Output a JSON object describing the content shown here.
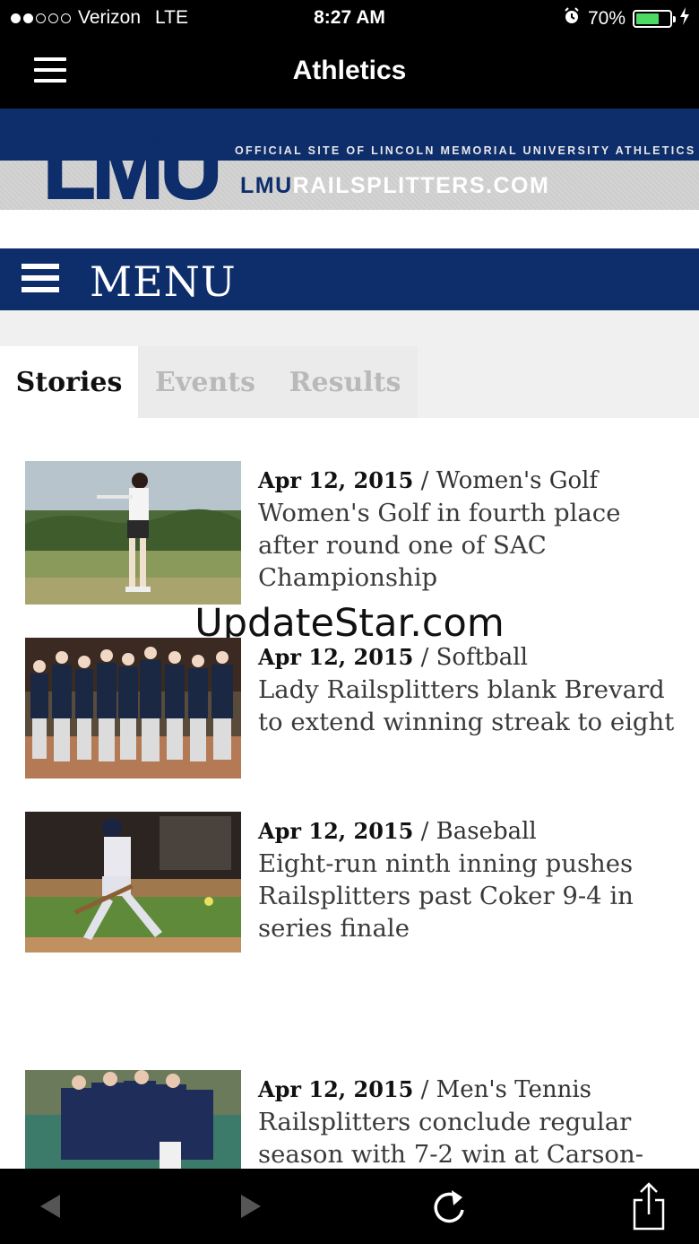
{
  "status_bar": {
    "carrier": "Verizon",
    "network": "LTE",
    "time": "8:27 AM",
    "battery": "70%",
    "battery_level": 0.7,
    "signal_bars_filled": 2,
    "signal_bars_total": 5
  },
  "nav": {
    "title": "Athletics",
    "menu_icon": "hamburger-icon"
  },
  "banner": {
    "logo_text": "LMU",
    "tagline": "OFFICIAL SITE OF LINCOLN MEMORIAL UNIVERSITY ATHLETICS",
    "url_part1": "LMU",
    "url_part2": "RAILSPLITTERS.COM",
    "brand_color": "#0d2d6b"
  },
  "menu": {
    "label": "MENU"
  },
  "tabs": [
    {
      "label": "Stories",
      "active": true
    },
    {
      "label": "Events",
      "active": false
    },
    {
      "label": "Results",
      "active": false
    }
  ],
  "stories": [
    {
      "date": "Apr 12, 2015",
      "separator": " / ",
      "sport": "Women's Golf",
      "title": "Women's Golf in fourth place after round one of SAC Championship"
    },
    {
      "date": "Apr 12, 2015",
      "separator": " / ",
      "sport": "Softball",
      "title": "Lady Railsplitters blank Brevard to extend winning streak to eight"
    },
    {
      "date": "Apr 12, 2015",
      "separator": " / ",
      "sport": "Baseball",
      "title": "Eight-run ninth inning pushes Railsplitters past Coker 9-4 in series finale"
    },
    {
      "date": "Apr 12, 2015",
      "separator": " / ",
      "sport": "Men's Tennis",
      "title": "Railsplitters conclude regular season with 7-2 win at Carson-"
    }
  ],
  "watermark": "UpdateStar.com",
  "toolbar": {
    "back_icon": "back-arrow-icon",
    "forward_icon": "forward-arrow-icon",
    "reload_icon": "reload-icon",
    "share_icon": "share-icon"
  }
}
